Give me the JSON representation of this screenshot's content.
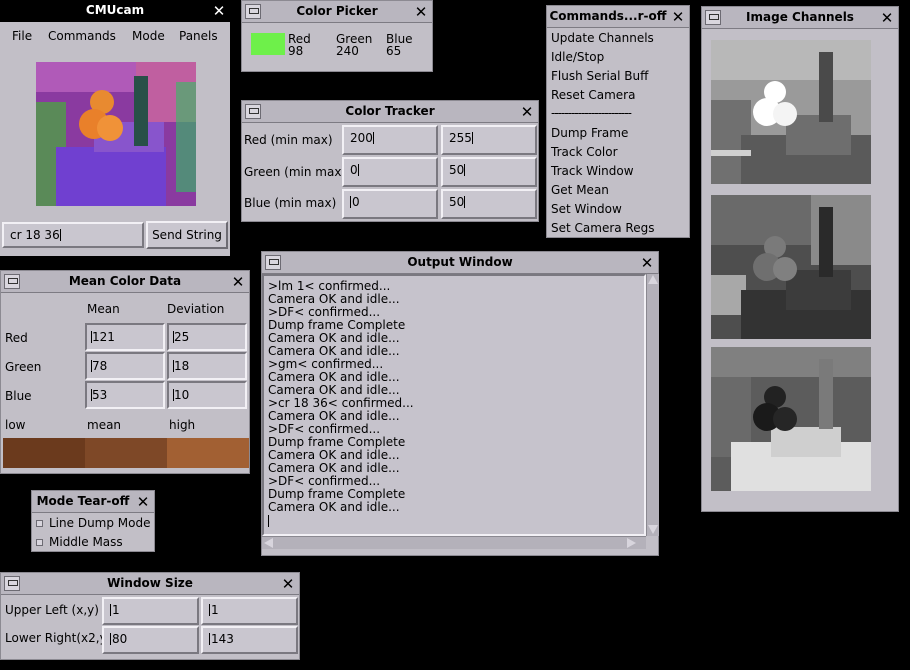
{
  "cmucam": {
    "title": "CMUcam",
    "menu": [
      "File",
      "Commands",
      "Mode",
      "Panels"
    ],
    "command_value": "cr 18 36",
    "send_label": "Send String"
  },
  "color_picker": {
    "title": "Color Picker",
    "swatch_color": "#6ef04a",
    "red_label": "Red",
    "red_value": "98",
    "green_label": "Green",
    "green_value": "240",
    "blue_label": "Blue",
    "blue_value": "65"
  },
  "color_tracker": {
    "title": "Color Tracker",
    "rows": [
      {
        "label": "Red (min max)",
        "min": "200",
        "max": "255"
      },
      {
        "label": "Green (min max",
        "min": "0",
        "max": "50"
      },
      {
        "label": "Blue (min max)",
        "min": "0",
        "max": "50"
      }
    ]
  },
  "commands": {
    "title": "Commands...r-off",
    "items": [
      "Update Channels",
      "Idle/Stop",
      "Flush Serial Buff",
      "Reset Camera"
    ],
    "separator": "------------------------",
    "items2": [
      "Dump Frame",
      "Track Color",
      "Track Window",
      "Get Mean",
      "Set Window",
      "Set Camera Regs"
    ]
  },
  "image_channels": {
    "title": "Image Channels"
  },
  "mean_color": {
    "title": "Mean Color Data",
    "col_mean": "Mean",
    "col_dev": "Deviation",
    "rows": [
      {
        "label": "Red",
        "mean": "121",
        "dev": "25"
      },
      {
        "label": "Green",
        "mean": "78",
        "dev": "18"
      },
      {
        "label": "Blue",
        "mean": "53",
        "dev": "10"
      }
    ],
    "low_label": "low",
    "mean_label": "mean",
    "high_label": "high",
    "swatch_low": "#6b3a1d",
    "swatch_mean": "#7e4827",
    "swatch_high": "#a26033"
  },
  "output": {
    "title": "Output Window",
    "lines": [
      ">lm 1< confirmed...",
      "Camera OK and idle...",
      ">DF< confirmed...",
      "Dump frame Complete",
      "Camera OK and idle...",
      "Camera OK and idle...",
      ">gm< confirmed...",
      "Camera OK and idle...",
      "Camera OK and idle...",
      ">cr 18 36< confirmed...",
      "Camera OK and idle...",
      ">DF< confirmed...",
      "Dump frame Complete",
      "Camera OK and idle...",
      "Camera OK and idle...",
      ">DF< confirmed...",
      "Dump frame Complete",
      "Camera OK and idle..."
    ]
  },
  "mode_tearoff": {
    "title": "Mode Tear-off",
    "items": [
      "Line Dump Mode",
      "Middle Mass"
    ]
  },
  "window_size": {
    "title": "Window Size",
    "upper_label": "Upper Left (x,y)",
    "upper_x": "1",
    "upper_y": "1",
    "lower_label": "Lower Right(x2,y",
    "lower_x": "80",
    "lower_y": "143"
  }
}
